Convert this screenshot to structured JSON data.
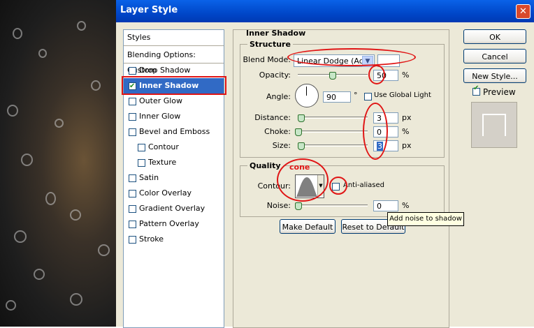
{
  "window": {
    "title": "Layer Style",
    "close_glyph": "✕"
  },
  "styles_list": [
    {
      "label": "Styles",
      "checkbox": false,
      "checked": false,
      "indent": 0,
      "selected": false
    },
    {
      "label": "Blending Options: Custom",
      "checkbox": false,
      "checked": false,
      "indent": 0,
      "selected": false
    },
    {
      "label": "Drop Shadow",
      "checkbox": true,
      "checked": false,
      "indent": 0,
      "selected": false
    },
    {
      "label": "Inner Shadow",
      "checkbox": true,
      "checked": true,
      "indent": 0,
      "selected": true
    },
    {
      "label": "Outer Glow",
      "checkbox": true,
      "checked": false,
      "indent": 0,
      "selected": false
    },
    {
      "label": "Inner Glow",
      "checkbox": true,
      "checked": false,
      "indent": 0,
      "selected": false
    },
    {
      "label": "Bevel and Emboss",
      "checkbox": true,
      "checked": false,
      "indent": 0,
      "selected": false
    },
    {
      "label": "Contour",
      "checkbox": true,
      "checked": false,
      "indent": 1,
      "selected": false
    },
    {
      "label": "Texture",
      "checkbox": true,
      "checked": false,
      "indent": 1,
      "selected": false
    },
    {
      "label": "Satin",
      "checkbox": true,
      "checked": false,
      "indent": 0,
      "selected": false
    },
    {
      "label": "Color Overlay",
      "checkbox": true,
      "checked": false,
      "indent": 0,
      "selected": false
    },
    {
      "label": "Gradient Overlay",
      "checkbox": true,
      "checked": false,
      "indent": 0,
      "selected": false
    },
    {
      "label": "Pattern Overlay",
      "checkbox": true,
      "checked": false,
      "indent": 0,
      "selected": false
    },
    {
      "label": "Stroke",
      "checkbox": true,
      "checked": false,
      "indent": 0,
      "selected": false
    }
  ],
  "inner_shadow": {
    "section_title": "Inner Shadow",
    "structure": {
      "group_title": "Structure",
      "blend_mode_label": "Blend Mode:",
      "blend_mode_value": "Linear Dodge (Add)",
      "opacity_label": "Opacity:",
      "opacity_value": "50",
      "opacity_unit": "%",
      "angle_label": "Angle:",
      "angle_value": "90",
      "angle_unit": "°",
      "use_global_light_label": "Use Global Light",
      "distance_label": "Distance:",
      "distance_value": "3",
      "distance_unit": "px",
      "choke_label": "Choke:",
      "choke_value": "0",
      "choke_unit": "%",
      "size_label": "Size:",
      "size_value": "3",
      "size_unit": "px"
    },
    "quality": {
      "group_title": "Quality",
      "contour_label": "Contour:",
      "anti_aliased_label": "Anti-aliased",
      "noise_label": "Noise:",
      "noise_value": "0",
      "noise_unit": "%"
    },
    "make_default_label": "Make Default",
    "reset_default_label": "Reset to Default"
  },
  "annotation": {
    "cone_text": "cone",
    "color": "#e01515"
  },
  "tooltip": "Add noise to shadow",
  "buttons": {
    "ok": "OK",
    "cancel": "Cancel",
    "new_style": "New Style...",
    "preview_label": "Preview"
  },
  "colors": {
    "title_bar": "#0a62e8",
    "selection": "#316ac5",
    "annotation_red": "#e01515"
  }
}
